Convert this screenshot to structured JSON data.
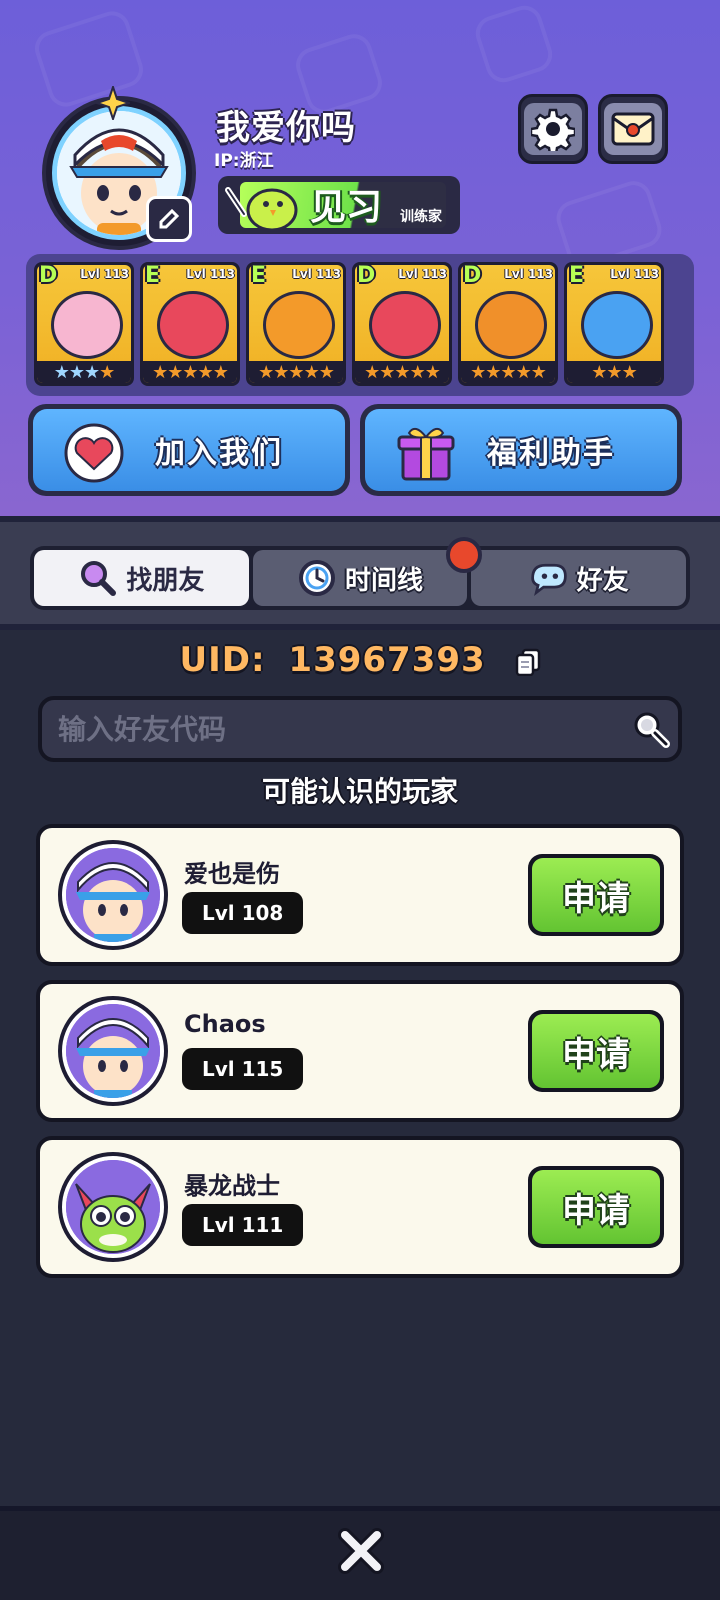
{
  "profile": {
    "username": "我爱你吗",
    "ip": "IP:浙江",
    "title_badge": {
      "main": "见习",
      "sub": "训练家"
    }
  },
  "monster_cards": [
    {
      "grade": "D",
      "level": "Lvl 113",
      "stars": 4,
      "color": "#f6c63a"
    },
    {
      "grade": "E",
      "level": "Lvl 113",
      "stars": 5,
      "color": "#f6c63a"
    },
    {
      "grade": "E",
      "level": "Lvl 113",
      "stars": 5,
      "color": "#f6c63a"
    },
    {
      "grade": "D",
      "level": "Lvl 113",
      "stars": 5,
      "color": "#f6c63a"
    },
    {
      "grade": "D",
      "level": "Lvl 113",
      "stars": 5,
      "color": "#f6c63a"
    },
    {
      "grade": "E",
      "level": "Lvl 113",
      "stars": 3,
      "color": "#f6c63a"
    }
  ],
  "actions": {
    "join_us": "加入我们",
    "welfare_helper": "福利助手"
  },
  "tabs": [
    {
      "label": "找朋友",
      "active": true
    },
    {
      "label": "时间线",
      "active": false
    },
    {
      "label": "好友",
      "active": false
    }
  ],
  "uid": {
    "label": "UID:",
    "value": "13967393"
  },
  "search": {
    "placeholder": "输入好友代码"
  },
  "section_title": "可能认识的玩家",
  "players": [
    {
      "name": "爱也是伤",
      "level": "Lvl 108",
      "button": "申请"
    },
    {
      "name": "Chaos",
      "level": "Lvl 115",
      "button": "申请"
    },
    {
      "name": "暴龙战士",
      "level": "Lvl 111",
      "button": "申请"
    }
  ],
  "colors": {
    "header_bg": "#7a62d6",
    "accent_green": "#7ed43e",
    "accent_blue": "#4aa2f2",
    "uid_orange": "#ffb862",
    "notify_red": "#e8482c"
  }
}
